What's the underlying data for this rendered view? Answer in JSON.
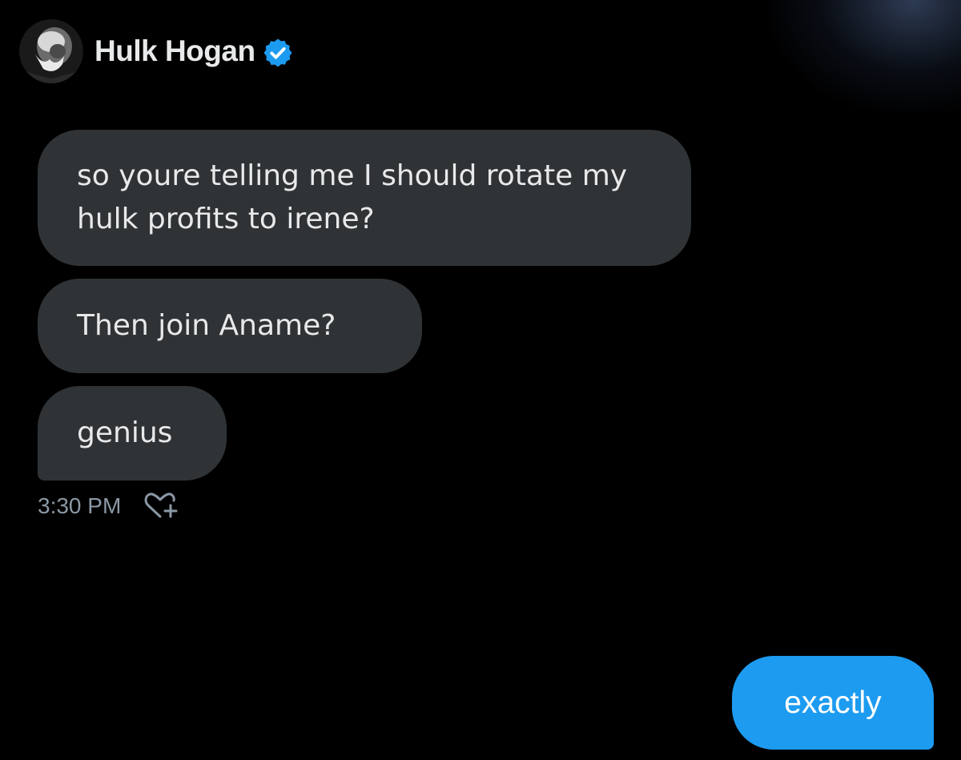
{
  "conversation": {
    "contact_name": "Hulk Hogan",
    "verified": true,
    "avatar_icon": "avatar-portrait",
    "verified_icon": "verified-badge-icon"
  },
  "messages": [
    {
      "direction": "incoming",
      "text": "so youre telling me I should rotate my hulk profits to irene?"
    },
    {
      "direction": "incoming",
      "text": "Then join Aname?"
    },
    {
      "direction": "incoming",
      "text": "genius"
    },
    {
      "direction": "outgoing",
      "text": "exactly"
    }
  ],
  "incoming_meta": {
    "timestamp": "3:30 PM",
    "react_icon": "add-reaction-heart-icon"
  },
  "colors": {
    "background": "#000000",
    "incoming_bubble": "#2f3336",
    "outgoing_bubble": "#1d9bf0",
    "text_primary": "#e7e9ea",
    "text_secondary": "#8b98a5",
    "verified_badge": "#1d9bf0"
  }
}
